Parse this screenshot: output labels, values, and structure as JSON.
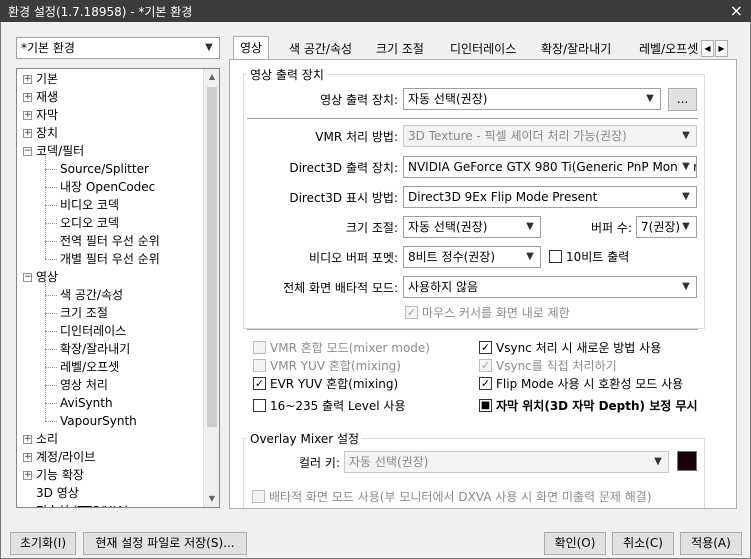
{
  "window": {
    "title": "환경 설정(1.7.18958) - *기본 환경",
    "close_icon": "×"
  },
  "profile_select": "*기본 환경",
  "tree": [
    {
      "label": "기본",
      "level": 0,
      "expander": "+"
    },
    {
      "label": "재생",
      "level": 0,
      "expander": "+"
    },
    {
      "label": "자막",
      "level": 0,
      "expander": "+"
    },
    {
      "label": "장치",
      "level": 0,
      "expander": "+"
    },
    {
      "label": "코덱/필터",
      "level": 0,
      "expander": "−"
    },
    {
      "label": "Source/Splitter",
      "level": 1
    },
    {
      "label": "내장 OpenCodec",
      "level": 1
    },
    {
      "label": "비디오 코덱",
      "level": 1
    },
    {
      "label": "오디오 코덱",
      "level": 1
    },
    {
      "label": "전역 필터 우선 순위",
      "level": 1
    },
    {
      "label": "개별 필터 우선 순위",
      "level": 1
    },
    {
      "label": "영상",
      "level": 0,
      "expander": "−"
    },
    {
      "label": "색 공간/속성",
      "level": 1
    },
    {
      "label": "크기 조절",
      "level": 1
    },
    {
      "label": "디인터레이스",
      "level": 1
    },
    {
      "label": "확장/잘라내기",
      "level": 1
    },
    {
      "label": "레벨/오프셋",
      "level": 1
    },
    {
      "label": "영상 처리",
      "level": 1
    },
    {
      "label": "AviSynth",
      "level": 1
    },
    {
      "label": "VapourSynth",
      "level": 1
    },
    {
      "label": "소리",
      "level": 0,
      "expander": "+"
    },
    {
      "label": "계정/라이브",
      "level": 0,
      "expander": "+"
    },
    {
      "label": "기능 확장",
      "level": 0,
      "expander": "+"
    },
    {
      "label": "3D 영상",
      "level": 0
    },
    {
      "label": "전송설 (TTS/UIA)",
      "level": 0,
      "expander": "+"
    }
  ],
  "tabs": [
    "영상",
    "색 공간/속성",
    "크기 조절",
    "디인터레이스",
    "확장/잘라내기",
    "레벨/오프셋"
  ],
  "tab_scroll": {
    "left": "◀",
    "right": "▶"
  },
  "output_group": {
    "title": "영상 출력 장치",
    "device_label": "영상 출력 장치:",
    "device_value": "자동 선택(권장)",
    "more_button": "...",
    "vmr_label": "VMR 처리 방법:",
    "vmr_value": "3D Texture - 픽셀 셰이더 처리 가능(권장)",
    "d3d_device_label": "Direct3D 출력 장치:",
    "d3d_device_value": "NVIDIA GeForce GTX 980 Ti(Generic PnP Monitor-",
    "d3d_mode_label": "Direct3D 표시 방법:",
    "d3d_mode_value": "Direct3D 9Ex Flip Mode Present",
    "resize_label": "크기 조절:",
    "resize_value": "자동 선택(권장)",
    "buffer_label": "버퍼 수:",
    "buffer_value": "7(권장)",
    "format_label": "비디오 버퍼 포멧:",
    "format_value": "8비트 정수(권장)",
    "tenbit_label": "10비트 출력",
    "exclusive_label": "전체 화면 배타적 모드:",
    "exclusive_value": "사용하지 않음",
    "mouse_label": "마우스 커서를 화면 내로 제한"
  },
  "options": {
    "vmr_mixer": "VMR 혼합 모드(mixer mode)",
    "vmr_yuv": "VMR YUV 혼합(mixing)",
    "evr_yuv": "EVR YUV 혼합(mixing)",
    "level_16_235": "16~235 출력 Level 사용",
    "vsync_new": "Vsync 처리 시 새로운 방법 사용",
    "vsync_direct": "Vsync를 직접 처리하기",
    "flip_compat": "Flip Mode 사용 시 호환성 모드 사용",
    "subtitle_depth": "자막 위치(3D 자막 Depth) 보정 무시"
  },
  "overlay_group": {
    "title": "Overlay Mixer 설정",
    "color_key_label": "컬러 키:",
    "color_key_value": "자동 선택(권장)",
    "color_key_swatch": "#1a0008",
    "exclusive_dxva": "배타적 화면 모드 사용(부 모니터에서 DXVA 사용 시 화면 미출력 문제 해결)"
  },
  "footer": {
    "reset": "초기화(I)",
    "save_file": "현재 설정 파일로 저장(S)...",
    "ok": "확인(O)",
    "cancel": "취소(C)",
    "apply": "적용(A)"
  }
}
